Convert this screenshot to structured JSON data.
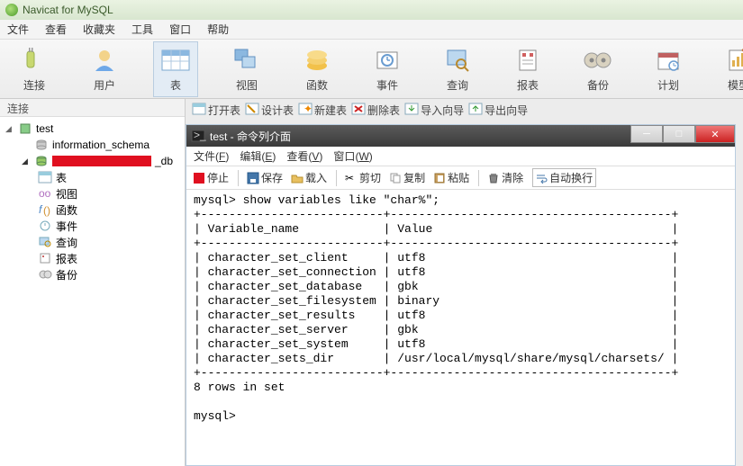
{
  "titlebar": {
    "title": "Navicat for MySQL"
  },
  "menubar": [
    "文件",
    "查看",
    "收藏夹",
    "工具",
    "窗口",
    "帮助"
  ],
  "ribbon": [
    {
      "name": "connect",
      "label": "连接"
    },
    {
      "name": "user",
      "label": "用户"
    },
    {
      "name": "table",
      "label": "表",
      "selected": true
    },
    {
      "name": "view",
      "label": "视图"
    },
    {
      "name": "function",
      "label": "函数"
    },
    {
      "name": "event",
      "label": "事件"
    },
    {
      "name": "query",
      "label": "查询"
    },
    {
      "name": "report",
      "label": "报表"
    },
    {
      "name": "backup",
      "label": "备份"
    },
    {
      "name": "schedule",
      "label": "计划"
    },
    {
      "name": "model",
      "label": "模型"
    }
  ],
  "sidebar": {
    "header": "连接",
    "root": {
      "label": "test"
    },
    "children": [
      {
        "label": "information_schema"
      },
      {
        "label_suffix": "_db",
        "redacted": true
      }
    ],
    "leaves": [
      {
        "name": "table",
        "label": "表"
      },
      {
        "name": "view",
        "label": "视图"
      },
      {
        "name": "function",
        "label": "函数"
      },
      {
        "name": "event",
        "label": "事件"
      },
      {
        "name": "query",
        "label": "查询"
      },
      {
        "name": "report",
        "label": "报表"
      },
      {
        "name": "backup",
        "label": "备份"
      }
    ]
  },
  "sec_toolbar": [
    {
      "name": "open",
      "label": "打开表"
    },
    {
      "name": "design",
      "label": "设计表"
    },
    {
      "name": "new",
      "label": "新建表"
    },
    {
      "name": "delete",
      "label": "删除表"
    },
    {
      "name": "import",
      "label": "导入向导"
    },
    {
      "name": "export",
      "label": "导出向导"
    }
  ],
  "console": {
    "title": "test - 命令列介面",
    "menus": [
      {
        "label": "文件",
        "key": "F"
      },
      {
        "label": "编辑",
        "key": "E"
      },
      {
        "label": "查看",
        "key": "V"
      },
      {
        "label": "窗口",
        "key": "W"
      }
    ],
    "tools": {
      "stop": "停止",
      "save": "保存",
      "load": "载入",
      "cut": "剪切",
      "copy": "复制",
      "paste": "粘贴",
      "clear": "清除",
      "wrap": "自动换行"
    },
    "output": "mysql> show variables like \"char%\";\n+--------------------------+----------------------------------------+\n| Variable_name            | Value                                  |\n+--------------------------+----------------------------------------+\n| character_set_client     | utf8                                   |\n| character_set_connection | utf8                                   |\n| character_set_database   | gbk                                    |\n| character_set_filesystem | binary                                 |\n| character_set_results    | utf8                                   |\n| character_set_server     | gbk                                    |\n| character_set_system     | utf8                                   |\n| character_sets_dir       | /usr/local/mysql/share/mysql/charsets/ |\n+--------------------------+----------------------------------------+\n8 rows in set\n\nmysql>"
  }
}
